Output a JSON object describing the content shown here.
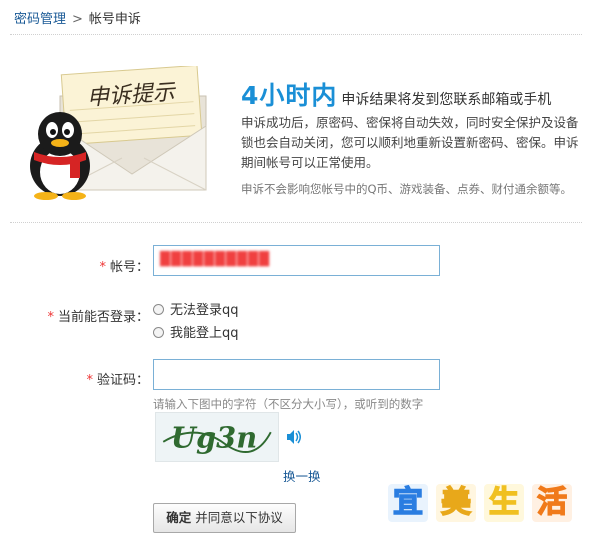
{
  "breadcrumb": {
    "parent": "密码管理",
    "separator": ">",
    "current": "帐号申诉"
  },
  "header": {
    "envelope_text": "申诉提示",
    "headline_big": "4小时内",
    "headline_rest": "申诉结果将发到您联系邮箱或手机",
    "description": "申诉成功后，原密码、密保将自动失效，同时安全保护及设备锁也会自动关闭，您可以顺利地重新设置新密码、密保。申诉期间帐号可以正常使用。",
    "note": "申诉不会影响您帐号中的Q币、游戏装备、点券、财付通余额等。"
  },
  "form": {
    "account": {
      "required_mark": "*",
      "label": "帐号：",
      "value": "██████████"
    },
    "login_status": {
      "required_mark": "*",
      "label": "当前能否登录：",
      "options": [
        "无法登录qq",
        "我能登上qq"
      ]
    },
    "captcha": {
      "required_mark": "*",
      "label": "验证码：",
      "hint": "请输入下图中的字符（不区分大小写），或听到的数字",
      "refresh_label": "换一换",
      "image_text": "Ug3n"
    },
    "submit": {
      "bold_label": "确定",
      "rest_label": "并同意以下协议"
    }
  },
  "watermark": {
    "chars": [
      "宜",
      "美",
      "生",
      "活"
    ]
  },
  "colors": {
    "accent_blue": "#1a8fd6",
    "link_blue": "#1a5a96",
    "required_red": "#e33333",
    "input_border": "#7ab0d6",
    "watermark": [
      "#2a7de1",
      "#e8a81a",
      "#f0c020",
      "#f07a1a"
    ]
  }
}
